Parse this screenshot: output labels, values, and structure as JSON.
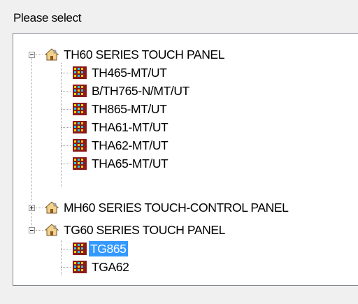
{
  "caption": "Please select",
  "tree": {
    "groups": [
      {
        "label": "TH60 SERIES TOUCH PANEL",
        "expanded": true,
        "items": [
          "TH465-MT/UT",
          "B/TH765-N/MT/UT",
          "TH865-MT/UT",
          "THA61-MT/UT",
          "THA62-MT/UT",
          "THA65-MT/UT"
        ]
      },
      {
        "label": "MH60 SERIES TOUCH-CONTROL PANEL",
        "expanded": false,
        "items": []
      },
      {
        "label": "TG60 SERIES TOUCH PANEL",
        "expanded": true,
        "items": [
          "TG865",
          "TGA62"
        ]
      }
    ],
    "selected": "TG865"
  },
  "colors": {
    "selection": "#3399ff",
    "house_icon": "#c8a060",
    "device_icon": "#8b1a1a"
  },
  "icons": {
    "group": "house-icon",
    "item": "device-icon"
  }
}
